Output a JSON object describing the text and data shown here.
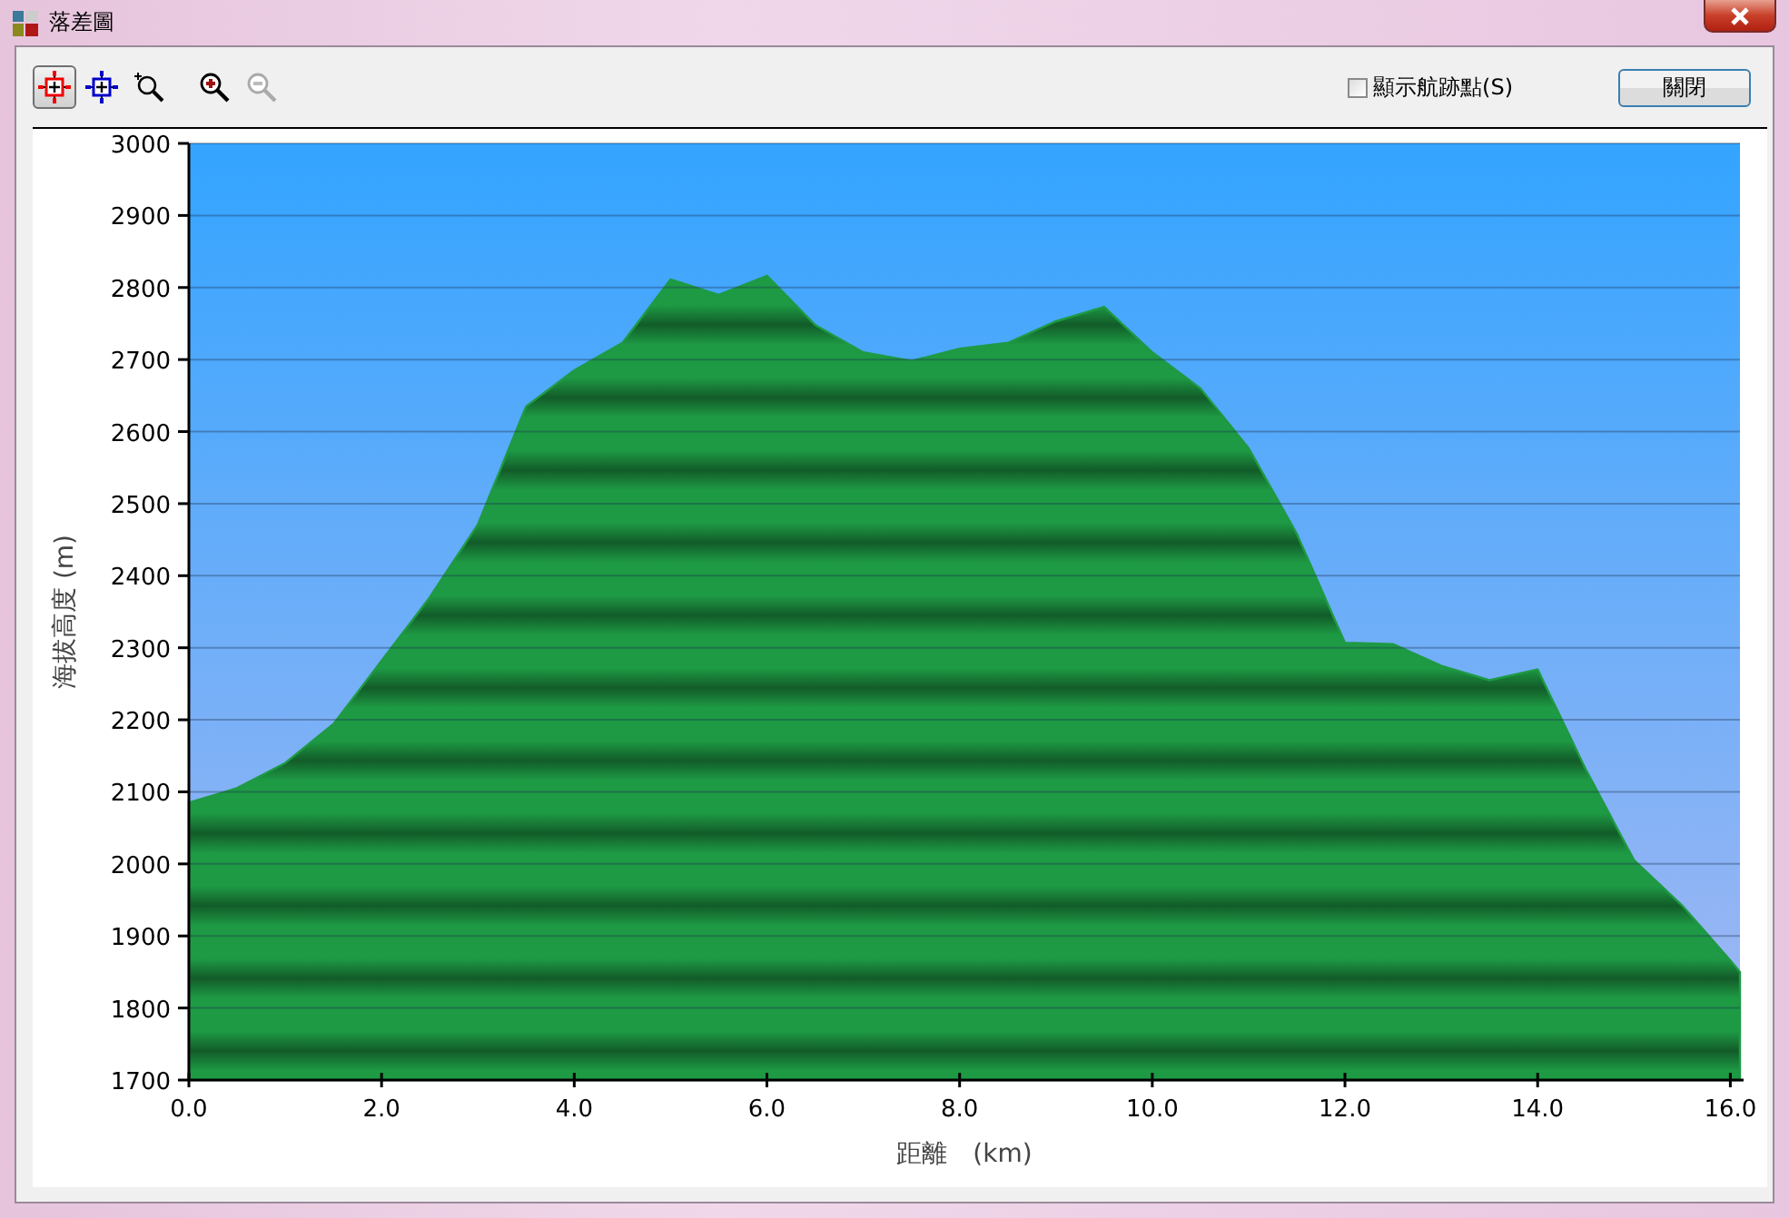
{
  "window": {
    "title": "落差圖"
  },
  "toolbar": [
    {
      "kind": "point-red",
      "selected": true,
      "disabled": false
    },
    {
      "kind": "point-blue",
      "selected": false,
      "disabled": false
    },
    {
      "kind": "zoom-area",
      "selected": false,
      "disabled": false
    },
    {
      "kind": "zoom-in",
      "selected": false,
      "disabled": false
    },
    {
      "kind": "zoom-out",
      "selected": false,
      "disabled": true
    }
  ],
  "show_track_points": {
    "label": "顯示航跡點(S)",
    "checked": false
  },
  "close_button": "關閉",
  "chart": {
    "chart_data": {
      "type": "area",
      "xlabel": "距離　(km)",
      "ylabel": "海拔高度 (m)",
      "x": [
        0,
        0.5,
        1,
        1.5,
        2,
        2.5,
        3,
        3.5,
        4,
        4.5,
        5,
        5.5,
        6,
        6.5,
        7,
        7.5,
        8,
        8.5,
        9,
        9.5,
        10,
        10.5,
        11,
        11.5,
        12,
        12.5,
        13,
        13.5,
        14,
        14.5,
        15,
        15.5,
        16,
        16.1
      ],
      "grid": true,
      "series": [
        {
          "color": "#1e9a44",
          "values": [
            2085,
            2105,
            2140,
            2194,
            2282,
            2370,
            2471,
            2635,
            2685,
            2723,
            2811,
            2790,
            2816,
            2748,
            2710,
            2698,
            2715,
            2723,
            2753,
            2773,
            2710,
            2660,
            2577,
            2458,
            2307,
            2305,
            2275,
            2255,
            2270,
            2131,
            2005,
            1942,
            1866,
            1850
          ]
        }
      ],
      "xlim": [
        0,
        16.1
      ],
      "ylim": [
        1700,
        3000
      ],
      "xticks": [
        {
          "value": 0,
          "label": "0.0"
        },
        {
          "value": 2,
          "label": "2.0"
        },
        {
          "value": 4,
          "label": "4.0"
        },
        {
          "value": 6,
          "label": "6.0"
        },
        {
          "value": 8,
          "label": "8.0"
        },
        {
          "value": 10,
          "label": "10.0"
        },
        {
          "value": 12,
          "label": "12.0"
        },
        {
          "value": 14,
          "label": "14.0"
        },
        {
          "value": 16,
          "label": "16.0"
        }
      ],
      "yticks": [
        1700,
        1800,
        1900,
        2000,
        2100,
        2200,
        2300,
        2400,
        2500,
        2600,
        2700,
        2800,
        2900,
        3000
      ]
    }
  }
}
